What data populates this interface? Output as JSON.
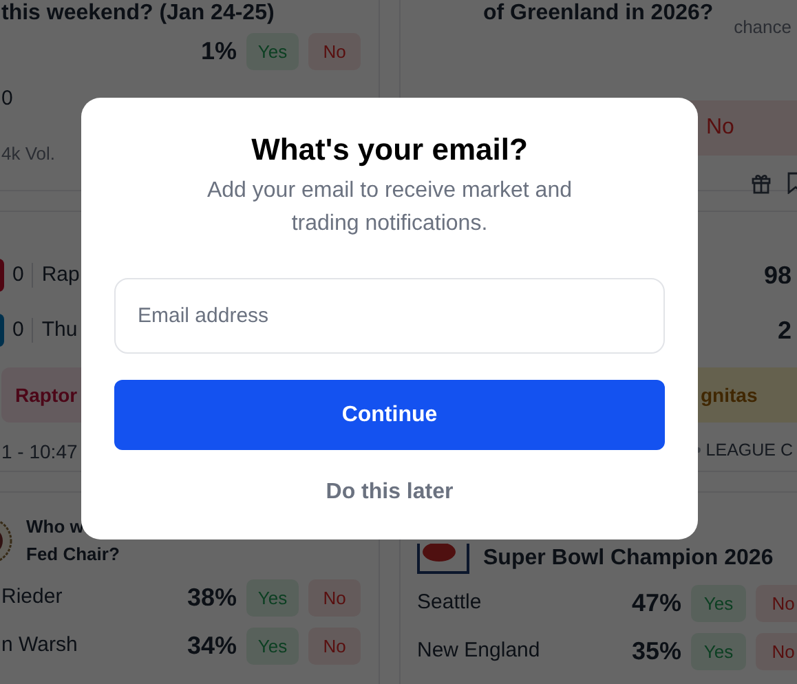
{
  "markets_left": [
    {
      "kind": "outcomes",
      "title": "this weekend? (Jan 24-25)",
      "rows": [
        {
          "chance": "1%",
          "yes": "Yes",
          "no": "No"
        },
        {
          "label": "0"
        }
      ],
      "footer": "4k Vol."
    },
    {
      "kind": "game",
      "teams": [
        {
          "score": "0",
          "name": "Rap",
          "color": "#500612"
        },
        {
          "score": "0",
          "name": "Thu",
          "color": "#00314d"
        }
      ],
      "pick": {
        "label": "Raptor",
        "color": "#645b5e"
      },
      "status": "1 - 10:47"
    },
    {
      "kind": "seal_outcomes",
      "title_lines": [
        "Who w",
        "Fed Chair?"
      ],
      "rows": [
        {
          "label": "Rieder",
          "chance": "38%",
          "yes": "Yes",
          "no": "No"
        },
        {
          "label": "n Warsh",
          "chance": "34%",
          "yes": "Yes",
          "no": "No"
        }
      ]
    }
  ],
  "markets_right": [
    {
      "kind": "teaser",
      "title": "of Greenland in 2026?",
      "side_label": "chance",
      "no": "No"
    },
    {
      "kind": "game",
      "teams": [
        {
          "chance": "98"
        },
        {
          "chance": "2"
        }
      ],
      "pick": {
        "label": "gnitas",
        "color": "#65614e"
      },
      "status": "LEAGUE C"
    },
    {
      "kind": "football_outcomes",
      "title": "Super Bowl Champion 2026",
      "rows": [
        {
          "label": "Seattle",
          "chance": "47%",
          "yes": "Yes",
          "no": "No"
        },
        {
          "label": "New England",
          "chance": "35%",
          "yes": "Yes",
          "no": "No"
        }
      ]
    }
  ],
  "modal": {
    "title": "What's your email?",
    "subtitle": "Add your email to receive market and trading notifications.",
    "email_field": {
      "placeholder": "Email address"
    },
    "primary_button": "Continue",
    "secondary_button": "Do this later"
  }
}
